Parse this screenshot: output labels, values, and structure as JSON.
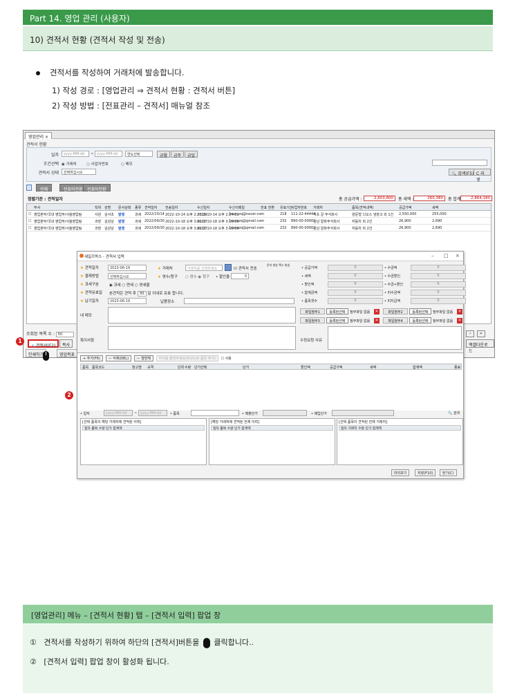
{
  "header": {
    "part": "Part 14. 영업 관리 (사용자)",
    "section": "10) 견적서 현황 (견적서 작성 및 전송)"
  },
  "body": {
    "bullet": "견적서를 작성하여 거래처에 발송합니다.",
    "line1": "1) 작성 경로 : [영업관리 ⇒ 견적서 현황 : 견적서 버튼]",
    "line2": "2) 작성 방법 : [전표관리 – 견적서] 매뉴얼 참조"
  },
  "screenshot": {
    "tab": "영업관리 ×",
    "crumb": "견적서 현황",
    "search": {
      "date_label": "일자",
      "date_from": "yyyy-MM-dd",
      "date_sep": "~",
      "date_to": "yyyy-MM-dd",
      "year_select": "연도선택",
      "btn_today": "금월",
      "btn_week": "금주",
      "btn_day": "금일",
      "cond_label": "조건선택",
      "radio1": "◉ 거래처",
      "radio2": "○ 사업자번호",
      "radio3": "○ 메모",
      "status_label": "견적서 상태",
      "status_value": "선택하십시오",
      "btn_search": "🔍 검색(F5)",
      "btn_reset": "C 리셋"
    },
    "filter_tabs": [
      "전체",
      "전표미전환",
      "전표미전환"
    ],
    "summary": {
      "basis": "정렬기준 : 견적일자",
      "supply_label": "총 공급가액 :",
      "supply_value": "2,603,800",
      "tax_label": "총 세액 :",
      "tax_value": "260,380",
      "total_label": "총 합계 :",
      "total_value": "2,864,180"
    },
    "columns": [
      "부서",
      "직위",
      "성명",
      "문서상태",
      "종류",
      "견적일자",
      "전송일자",
      "수신일자",
      "수신이메일",
      "전표 전환",
      "유효기간",
      "사업자번호",
      "거래처",
      "품목(견적내역)",
      "공급가액",
      "세액"
    ],
    "rows": [
      [
        "영업본부/국내 영업부/서울영업팀",
        "사원",
        "김서초",
        "발행",
        "과세",
        "2022/10/14",
        "2022-10-14 오후 2:23:29",
        "2022-10-14 오후 2:24:11",
        "1caruzq@naver.com",
        "-",
        "218",
        "111-22-44444",
        "서초 갈 주식회사",
        "양문형 디오스 냉장고 외 1건",
        "2,550,000",
        "255,000"
      ],
      [
        "영업본부/국내 영업부/서울영업팀",
        "과장",
        "김강남",
        "발행",
        "과세",
        "2022/09/30",
        "2022-10-18 오후 3:02:17",
        "2022-10-18 오후 3:16:16",
        "1caruzq@gmail.com",
        "-",
        "232",
        "890-00-00001",
        "강남 알파주식회사",
        "자동차 외 2건",
        "26,900",
        "2,690"
      ],
      [
        "영업본부/국내 영업부/서울영업팀",
        "과장",
        "김강남",
        "발행",
        "과세",
        "2022/09/30",
        "2022-10-18 오후 3:02:17",
        "2022-10-18 오후 3:16:16",
        "1caruzq@gmail.com",
        "-",
        "232",
        "890-00-00001",
        "강남 알파주식회사",
        "자동차 외 2건",
        "26,900",
        "2,690"
      ]
    ],
    "count_label": "조회된 목록 수 :",
    "count_value": "50",
    "btn_quote": "견적서(F2)",
    "btn_copy": "복사",
    "btn_print": "인쇄하기",
    "btn_email": "영업목표",
    "btn_excel": "엑셀다운로드"
  },
  "popup": {
    "title": "세일즈박스 - 견적서 입력",
    "left_fields": {
      "date_label": "견적일자",
      "date_value": "2023-06-19",
      "pay_label": "결제방법",
      "pay_value": "선택하십시오",
      "tax_label": "과세구분",
      "tax_options": "◉ 과세 ○ 면세 ○ 영세율",
      "valid_label": "견적유효일",
      "valid_text": "본견적은 견적 후",
      "valid_days": "30",
      "valid_suffix": "일 이내로 유효 합니다.",
      "delivery_label": "납기일자",
      "delivery_value": "2023-06-19",
      "place_label": "납품장소",
      "memo_label": "내 메모",
      "note_label": "특이사항"
    },
    "mid_fields": {
      "client_label": "거래처",
      "client_placeholder": "거래처를 선택하세요",
      "email_check": "견적서 전송",
      "email_opts": "문자 발송 팩스 발송",
      "receipt_label": "영수/청구",
      "receipt_opts": "○ 영수 ◉ 청구",
      "discount_label": "할인율",
      "discount_value": "0"
    },
    "right_col1": [
      {
        "label": "공급가액",
        "value": "0"
      },
      {
        "label": "세액",
        "value": "0"
      },
      {
        "label": "할인액",
        "value": "0"
      },
      {
        "label": "합계금액",
        "value": "0"
      },
      {
        "label": "품목갯수",
        "value": "0"
      }
    ],
    "right_col2": [
      {
        "label": "수금액",
        "value": "0"
      },
      {
        "label": "수금할인",
        "value": "0"
      },
      {
        "label": "수금+할인",
        "value": "0"
      },
      {
        "label": "미수금액",
        "value": "0"
      },
      {
        "label": "미지급액",
        "value": "0"
      }
    ],
    "attach": {
      "f1": "파일첨부1",
      "f2": "파일첨부2",
      "f3": "파일첨부3",
      "f4": "파일첨부4",
      "btn": "등록된선택",
      "none": "첨부파일 없음",
      "x": "×"
    },
    "modify_label": "수정요청 사유",
    "toolbar": {
      "add": "+ 추가(F6)",
      "del": "— 삭제(DEL)",
      "delall": "— 행전체",
      "hint": "커서를 올려주세요(바코드로 품목 추가)",
      "check": "사용"
    },
    "item_columns": [
      "품목",
      "품목코드",
      "창고명",
      "규격",
      "단위",
      "수량",
      "단가선택",
      "단가",
      "할인액",
      "공급가액",
      "세액",
      "합계액",
      "종료"
    ],
    "filter": {
      "date_label": "• 일자",
      "from": "yyyy-MM-dd",
      "to": "yyyy-MM-dd",
      "item_label": "• 품목",
      "sale_label": "• 매출단가",
      "buy_label": "• 매입단가",
      "btn": "🔍 검색"
    },
    "panels": [
      {
        "title": "[선택 품목의 해당 거래처에 견적된 이력]",
        "cols": "일자  품목            수량  단가          합계액"
      },
      {
        "title": "[해당 거래처에 견적된 전체 이력]",
        "cols": "일자  품목            수량  단가          합계액"
      },
      {
        "title": "[선택 품목이 견적된 전체 거래처]",
        "cols": "일자  거래처          수량  단가          합계액"
      }
    ],
    "buttons": {
      "preview": "미리보기",
      "save": "저장(F10)",
      "close": "닫기(C)"
    }
  },
  "markers": {
    "one": "1",
    "two": "2"
  },
  "bottom": {
    "title": "[영업관리] 메뉴 – [견적서 현황] 탭 – [견적서 입력] 팝업 창",
    "step1_num": "①",
    "step1_a": "견적서를 작성하기 위하여 하단의 [견적서]버튼을",
    "step1_b": "클릭합니다..",
    "step2_num": "②",
    "step2": "[견적서 입력]  팝업 창이 활성화 됩니다."
  }
}
